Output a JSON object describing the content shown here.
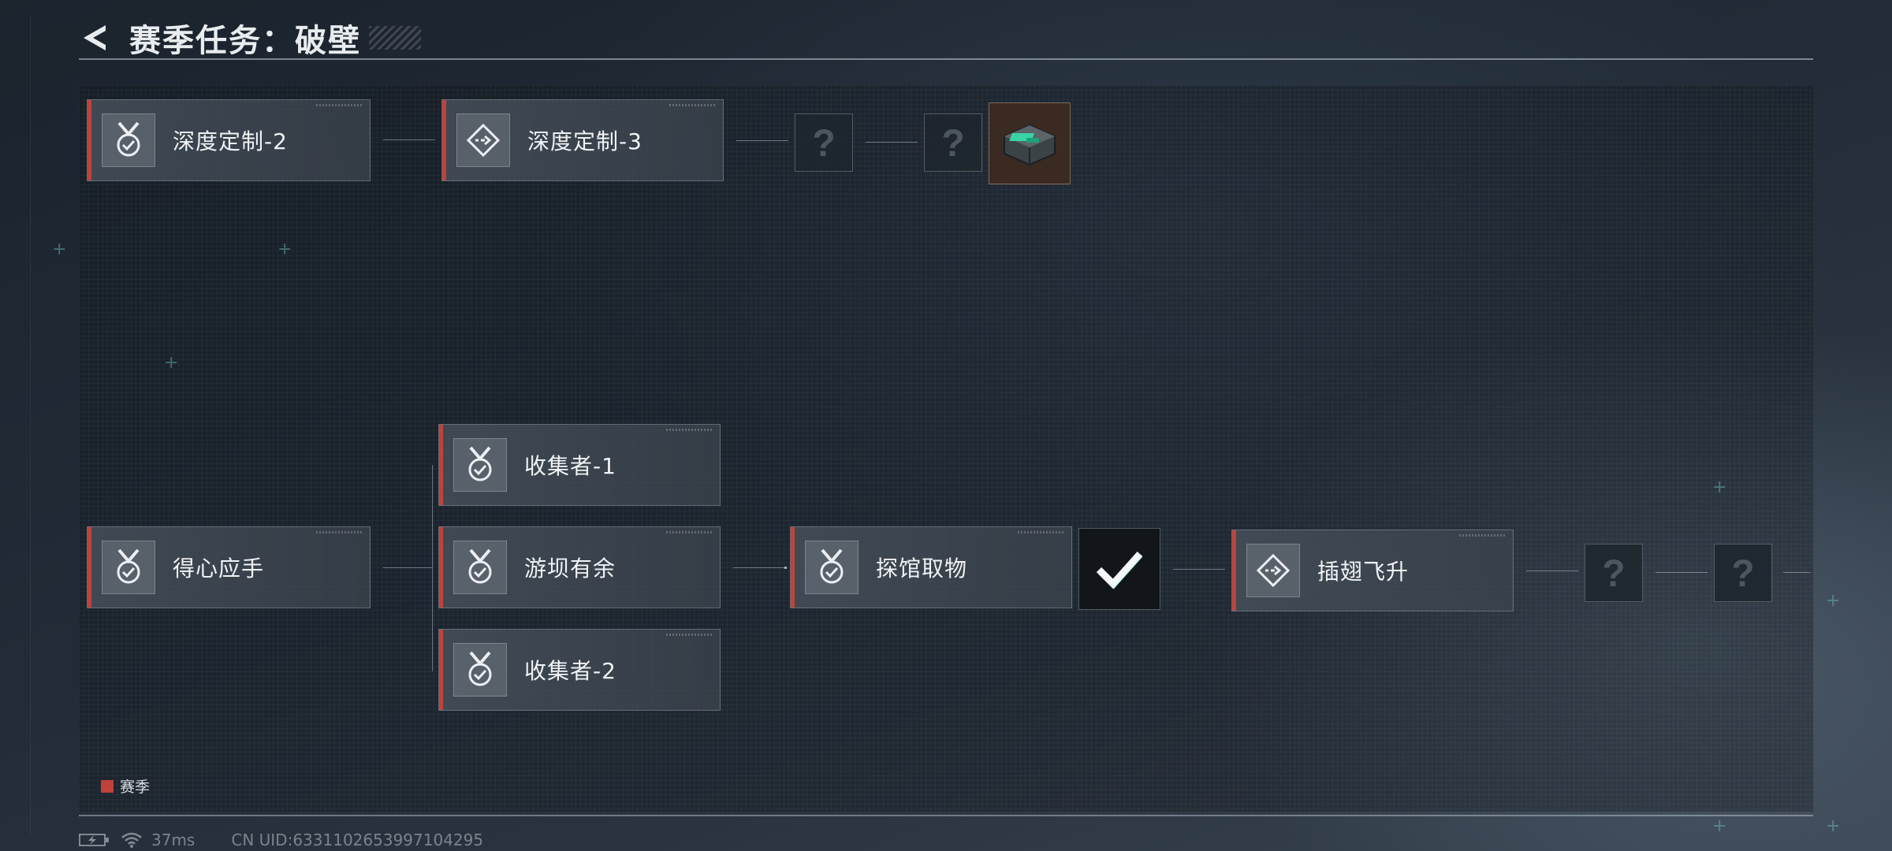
{
  "header": {
    "title": "赛季任务：破壁"
  },
  "top_chain": {
    "nodes": [
      {
        "label": "深度定制-2",
        "icon": "medal-check-icon"
      },
      {
        "label": "深度定制-3",
        "icon": "diamond-arrow-icon"
      }
    ],
    "unknowns": [
      "?",
      "?"
    ],
    "reward_icon": "device-reward-icon"
  },
  "bottom_chain": {
    "start": {
      "label": "得心应手",
      "icon": "medal-check-icon"
    },
    "branches": [
      {
        "label": "收集者-1",
        "icon": "medal-check-icon"
      },
      {
        "label": "游坝有余",
        "icon": "medal-check-icon"
      },
      {
        "label": "收集者-2",
        "icon": "medal-check-icon"
      }
    ],
    "merge": {
      "label": "探馆取物",
      "icon": "medal-check-icon"
    },
    "completed_icon": "checkmark-icon",
    "next": {
      "label": "插翅飞升",
      "icon": "diamond-arrow-icon"
    },
    "unknowns": [
      "?",
      "?"
    ]
  },
  "legend": {
    "label": "赛季",
    "color": "#c0423b"
  },
  "status_bar": {
    "ping": "37ms",
    "uid": "CN UID:6331102653997104295"
  },
  "colors": {
    "accent": "#c0423b",
    "text": "#f1f3f5"
  }
}
